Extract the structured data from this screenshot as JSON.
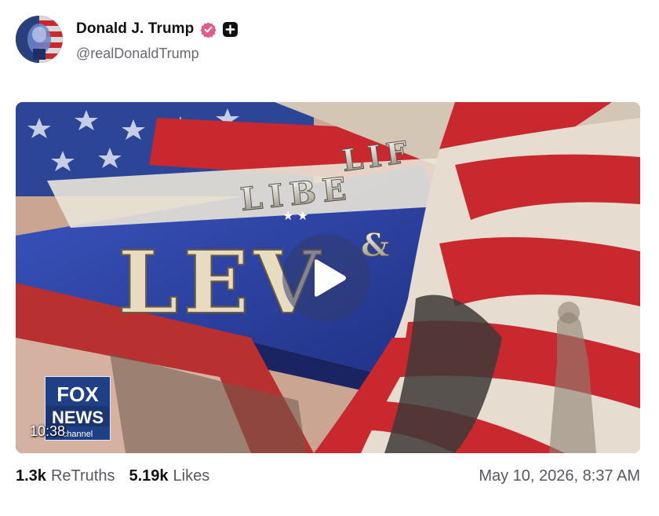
{
  "post": {
    "author": {
      "display_name": "Donald J. Trump",
      "handle": "@realDonaldTrump",
      "verified_icon": "verified-badge-icon",
      "plus_icon": "plus-square-icon"
    },
    "media": {
      "type": "video",
      "duration": "10:38",
      "play_icon": "play-icon",
      "logo": "FOX NEWS channel",
      "title_text": "LIF LIBE & LEV"
    },
    "stats": {
      "retruths_count": "1.3k",
      "retruths_label": "ReTruths",
      "likes_count": "5.19k",
      "likes_label": "Likes"
    },
    "timestamp": "May 10, 2026, 8:37 AM"
  },
  "colors": {
    "verified": "#e45a8c",
    "flag_red": "#c8282e",
    "flag_blue": "#2f47a8",
    "play_overlay": "#323c6e"
  }
}
